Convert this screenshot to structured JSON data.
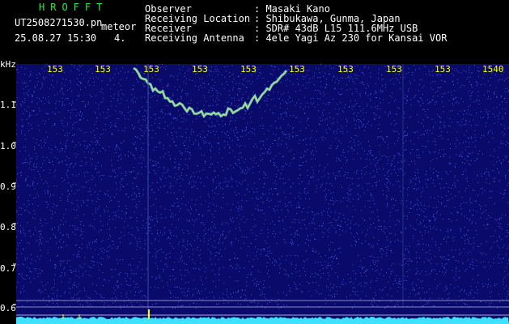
{
  "header": {
    "brand": "HROFFT",
    "file_name": "UT2508271530.pn",
    "image_type": "meteor",
    "timestamp": "25.08.27 15:30",
    "count": "4.",
    "fields": [
      {
        "label": "Observer",
        "value": ": Masaki Kano"
      },
      {
        "label": "Receiving Location",
        "value": ": Shibukawa, Gunma, Japan"
      },
      {
        "label": "Receiver",
        "value": ": SDR# 43dB L15 111.6MHz USB"
      },
      {
        "label": "Receiving Antenna",
        "value": ": 4ele Yagi Az 230 for Kansai VOR"
      }
    ]
  },
  "spectrogram": {
    "y_unit": "kHz",
    "y_ticks": [
      "1.1",
      "1.0",
      "0.9",
      "0.8",
      "0.7",
      "0.6"
    ],
    "x_ticks": [
      "153",
      "153",
      "153",
      "153",
      "153",
      "153",
      "153",
      "153",
      "153",
      "1540"
    ],
    "colors": {
      "background": "#0a0a6a",
      "noise_light": "#5a6aff",
      "echo": "#7ee6c0",
      "echo_hot": "#ffee55",
      "baseline": "#40e0ff",
      "label": "#ffff00"
    }
  }
}
